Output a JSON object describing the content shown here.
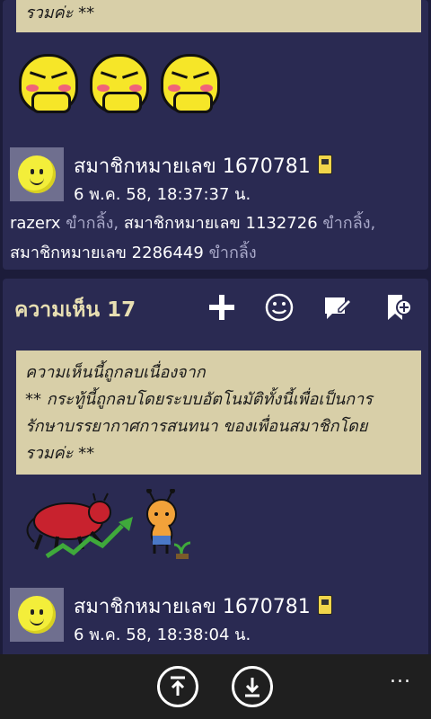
{
  "posts": [
    {
      "quote_tail": "รวมค่ะ **",
      "author": "สมาชิกหมายเลข 1670781",
      "timestamp": "6 พ.ค. 58, 18:37:37 น.",
      "likes_text_1": "razerx",
      "likes_sep_1": " ขำกลิ้ง, ",
      "likes_text_2": "สมาชิกหมายเลข 1132726",
      "likes_sep_2": " ขำกลิ้ง, ",
      "likes_text_3": "สมาชิกหมายเลข 2286449",
      "likes_sep_3": " ขำกลิ้ง"
    }
  ],
  "comment": {
    "title": "ความเห็น 17",
    "quote_line1": "ความเห็นนี้ถูกลบเนื่องจาก",
    "quote_line2": "** กระทู้นี้ถูกลบโดยระบบอัตโนมัติทั้งนี้เพื่อเป็นการ",
    "quote_line3": "รักษาบรรยากาศการสนทนา ของเพื่อนสมาชิกโดย",
    "quote_line4": "รวมค่ะ **",
    "author": "สมาชิกหมายเลข 1670781",
    "timestamp": "6 พ.ค. 58, 18:38:04 น."
  },
  "toolbar": {
    "icons": [
      "plus-icon",
      "smiley-icon",
      "reply-icon",
      "bookmark-add-icon"
    ]
  },
  "appbar": {
    "icons": [
      "scroll-top-icon",
      "download-icon"
    ],
    "more": "..."
  },
  "colors": {
    "background": "#1c1c3a",
    "card": "#2a2a52",
    "quote_bg": "#d8cfa8",
    "title": "#e8dfb2"
  }
}
